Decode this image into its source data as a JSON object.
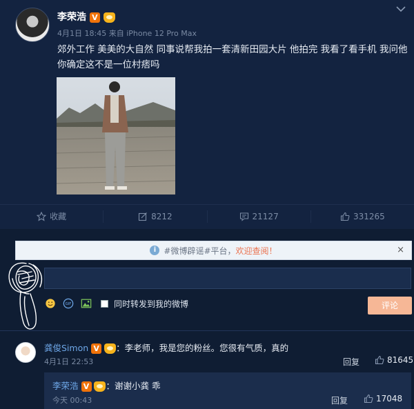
{
  "post": {
    "username": "李荣浩",
    "verified_badge": "V",
    "date": "4月1日 18:45",
    "source": "来自 iPhone 12 Pro Max",
    "text": "郊外工作 美美的大自然 同事说帮我拍一套清新田园大片 他拍完 我看了看手机 我问他 你确定这不是一位村痞吗",
    "actions": {
      "favorite_label": "收藏",
      "repost_count": "8212",
      "comment_count": "21127",
      "like_count": "331265"
    }
  },
  "rumor_bar": {
    "text": "#微博辟谣#平台，",
    "link": "欢迎查阅！",
    "close": "×"
  },
  "composer": {
    "input_value": "",
    "repost_checkbox_label": "同时转发到我的微博",
    "submit_label": "评论"
  },
  "comments": [
    {
      "name": "龚俊Simon",
      "verified_badge": "V",
      "text": "：李老师，我是您的粉丝。您很有气质，真的",
      "time": "4月1日 22:53",
      "reply_label": "回复",
      "likes": "81645",
      "reply": {
        "name": "李荣浩",
        "verified_badge": "V",
        "text": "：谢谢小龚 乖",
        "time": "今天 00:43",
        "reply_label": "回复",
        "likes": "17048"
      }
    }
  ],
  "colors": {
    "background": "#0f1d33",
    "post_bg": "#132340",
    "link": "#eb7350",
    "name_link": "#6ea7e8",
    "verified": "#f0730a",
    "submit": "#f6b796"
  }
}
